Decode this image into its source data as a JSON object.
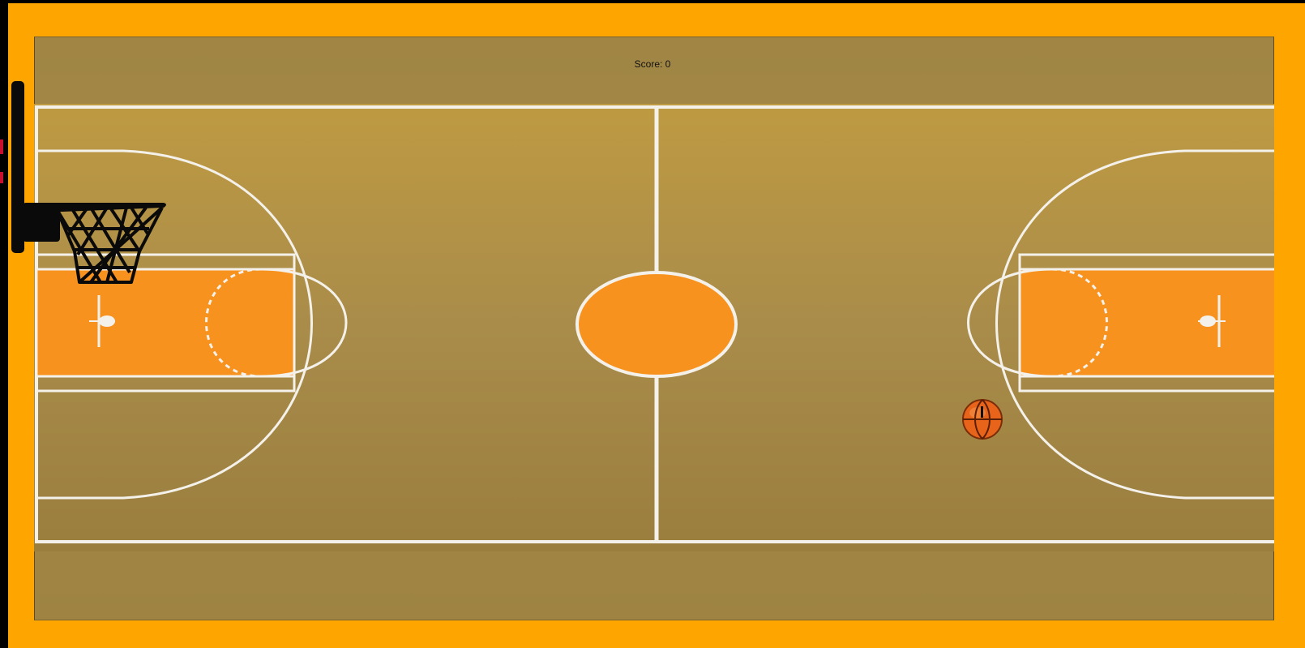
{
  "game": {
    "score_label": "Score: 0",
    "score": 0
  },
  "colors": {
    "frame": "#FFA500",
    "court_floor": "#B8943E",
    "paint": "#F7921E",
    "lines": "#FFFFFF",
    "ball": "#E8641B"
  },
  "objects": {
    "hoop": "basketball-hoop",
    "ball": "basketball"
  }
}
